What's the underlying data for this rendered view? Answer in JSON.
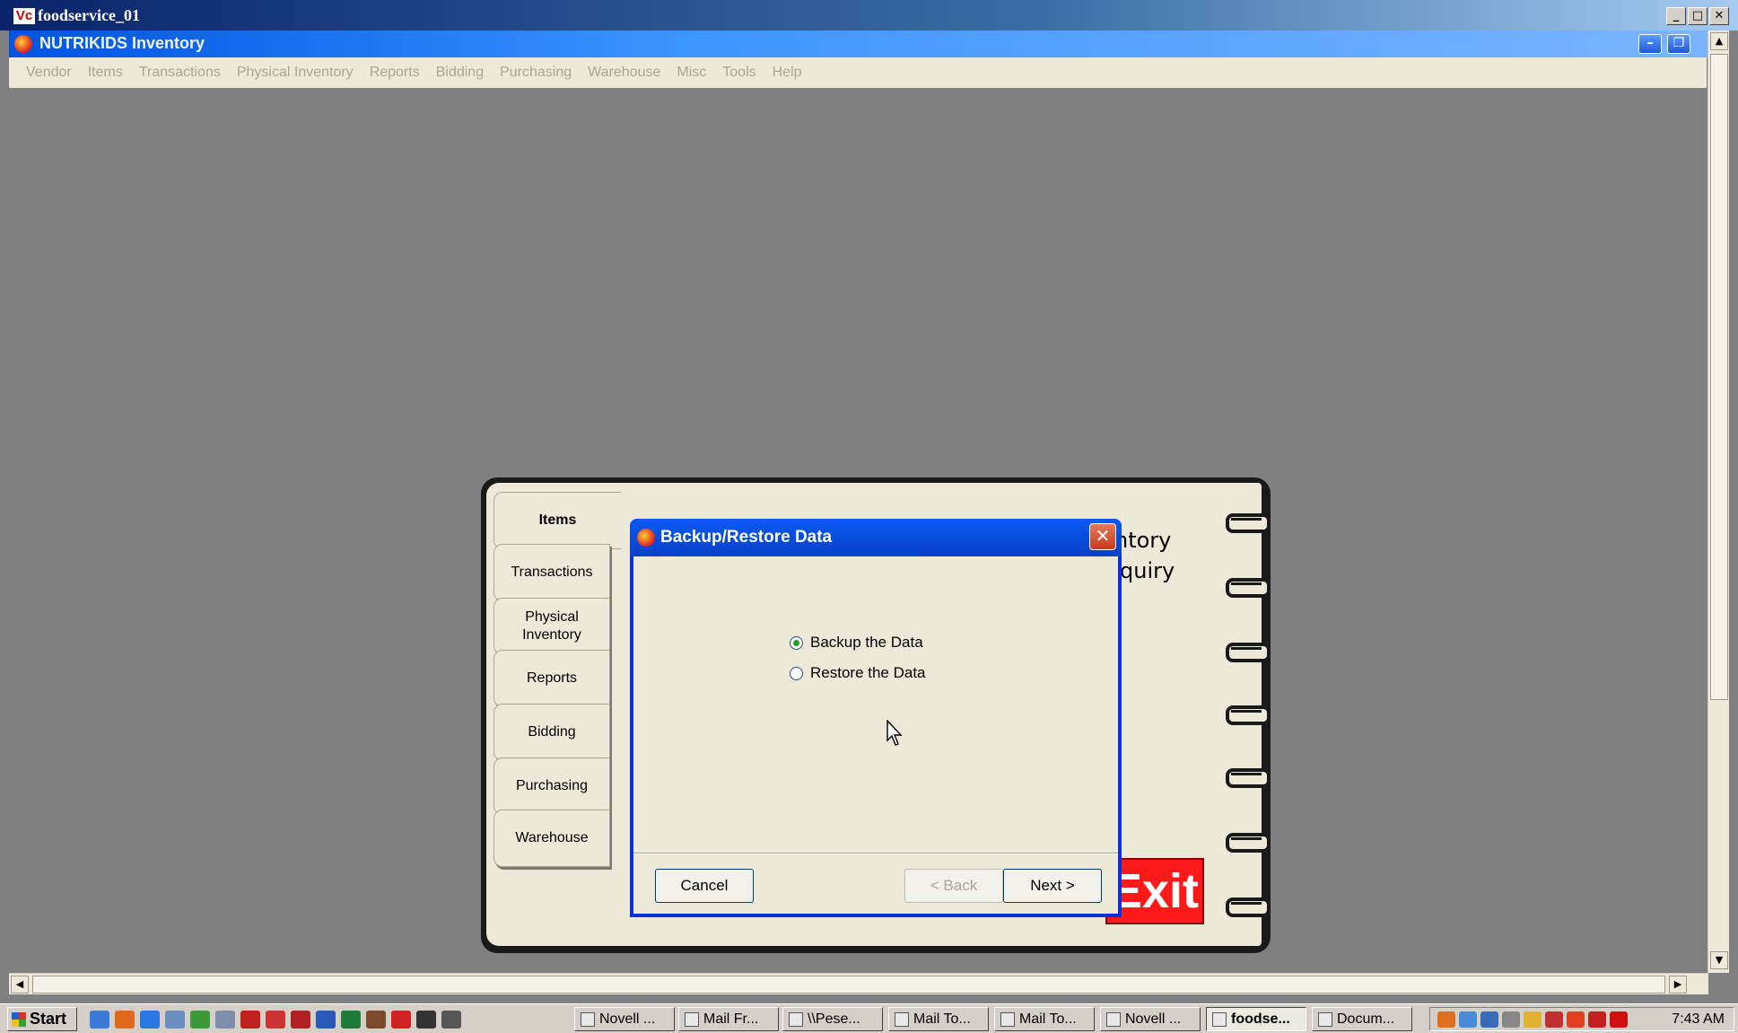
{
  "window": {
    "title": "foodservice_01",
    "logo_text": "Vc",
    "min_glyph": "_",
    "max_glyph": "□",
    "close_glyph": "✕"
  },
  "app": {
    "title": "NUTRIKIDS Inventory",
    "min_glyph": "–",
    "restore_glyph": "❐"
  },
  "menu": [
    "Vendor",
    "Items",
    "Transactions",
    "Physical Inventory",
    "Reports",
    "Bidding",
    "Purchasing",
    "Warehouse",
    "Misc",
    "Tools",
    "Help"
  ],
  "notebook": {
    "tabs": [
      {
        "label": "Items",
        "active": true
      },
      {
        "label": "Transactions"
      },
      {
        "label": "Physical Inventory"
      },
      {
        "label": "Reports"
      },
      {
        "label": "Bidding"
      },
      {
        "label": "Purchasing"
      },
      {
        "label": "Warehouse"
      }
    ],
    "page_line1": "ntory",
    "page_line2": "quiry",
    "exit_label": "Exit"
  },
  "dialog": {
    "title": "Backup/Restore Data",
    "close_glyph": "✕",
    "options": [
      {
        "label": "Backup the Data",
        "checked": true
      },
      {
        "label": "Restore the Data",
        "checked": false
      }
    ],
    "cancel_label": "Cancel",
    "back_label": "< Back",
    "next_label": "Next >"
  },
  "scrollbars": {
    "up": "▲",
    "down": "▼",
    "left": "◀",
    "right": "▶"
  },
  "taskbar": {
    "start_label": "Start",
    "quick_launch": [
      {
        "name": "outlook-icon",
        "color": "#3a7bd5"
      },
      {
        "name": "firefox-icon",
        "color": "#e06a1b"
      },
      {
        "name": "ie-icon",
        "color": "#2b78e4"
      },
      {
        "name": "network-icon",
        "color": "#6a8fbf"
      },
      {
        "name": "messenger-icon",
        "color": "#3a9a3a"
      },
      {
        "name": "computer-icon",
        "color": "#7d8ea8"
      },
      {
        "name": "vc-icon",
        "color": "#c02020"
      },
      {
        "name": "novell-icon",
        "color": "#cc3333"
      },
      {
        "name": "acrobat-icon",
        "color": "#b02020"
      },
      {
        "name": "word-icon",
        "color": "#2a5ab8"
      },
      {
        "name": "excel-icon",
        "color": "#1f7a3a"
      },
      {
        "name": "tool-icon",
        "color": "#7a4a2a"
      },
      {
        "name": "tc-icon",
        "color": "#d02020"
      },
      {
        "name": "film-icon",
        "color": "#333333"
      },
      {
        "name": "printer-icon",
        "color": "#555555"
      }
    ],
    "tasks": [
      {
        "label": "Novell ...",
        "active": false
      },
      {
        "label": "Mail Fr...",
        "active": false
      },
      {
        "label": "\\\\Pese...",
        "active": false
      },
      {
        "label": "Mail To...",
        "active": false
      },
      {
        "label": "Mail To...",
        "active": false
      },
      {
        "label": "Novell ...",
        "active": false
      },
      {
        "label": "foodse...",
        "active": true
      },
      {
        "label": "Docum...",
        "active": false
      }
    ],
    "tray_icons": [
      {
        "name": "tray-alert-icon",
        "color": "#e07020"
      },
      {
        "name": "tray-globe-icon",
        "color": "#4a8ad8"
      },
      {
        "name": "tray-network-icon",
        "color": "#3a6ab8"
      },
      {
        "name": "tray-search-icon",
        "color": "#888888"
      },
      {
        "name": "tray-folder-icon",
        "color": "#e0b030"
      },
      {
        "name": "tray-chart-icon",
        "color": "#c03030"
      },
      {
        "name": "tray-nutrikids-icon",
        "color": "#e04020"
      },
      {
        "name": "tray-vc-icon",
        "color": "#c02020"
      },
      {
        "name": "tray-novell-icon",
        "color": "#d01010"
      }
    ],
    "clock": "7:43 AM"
  }
}
